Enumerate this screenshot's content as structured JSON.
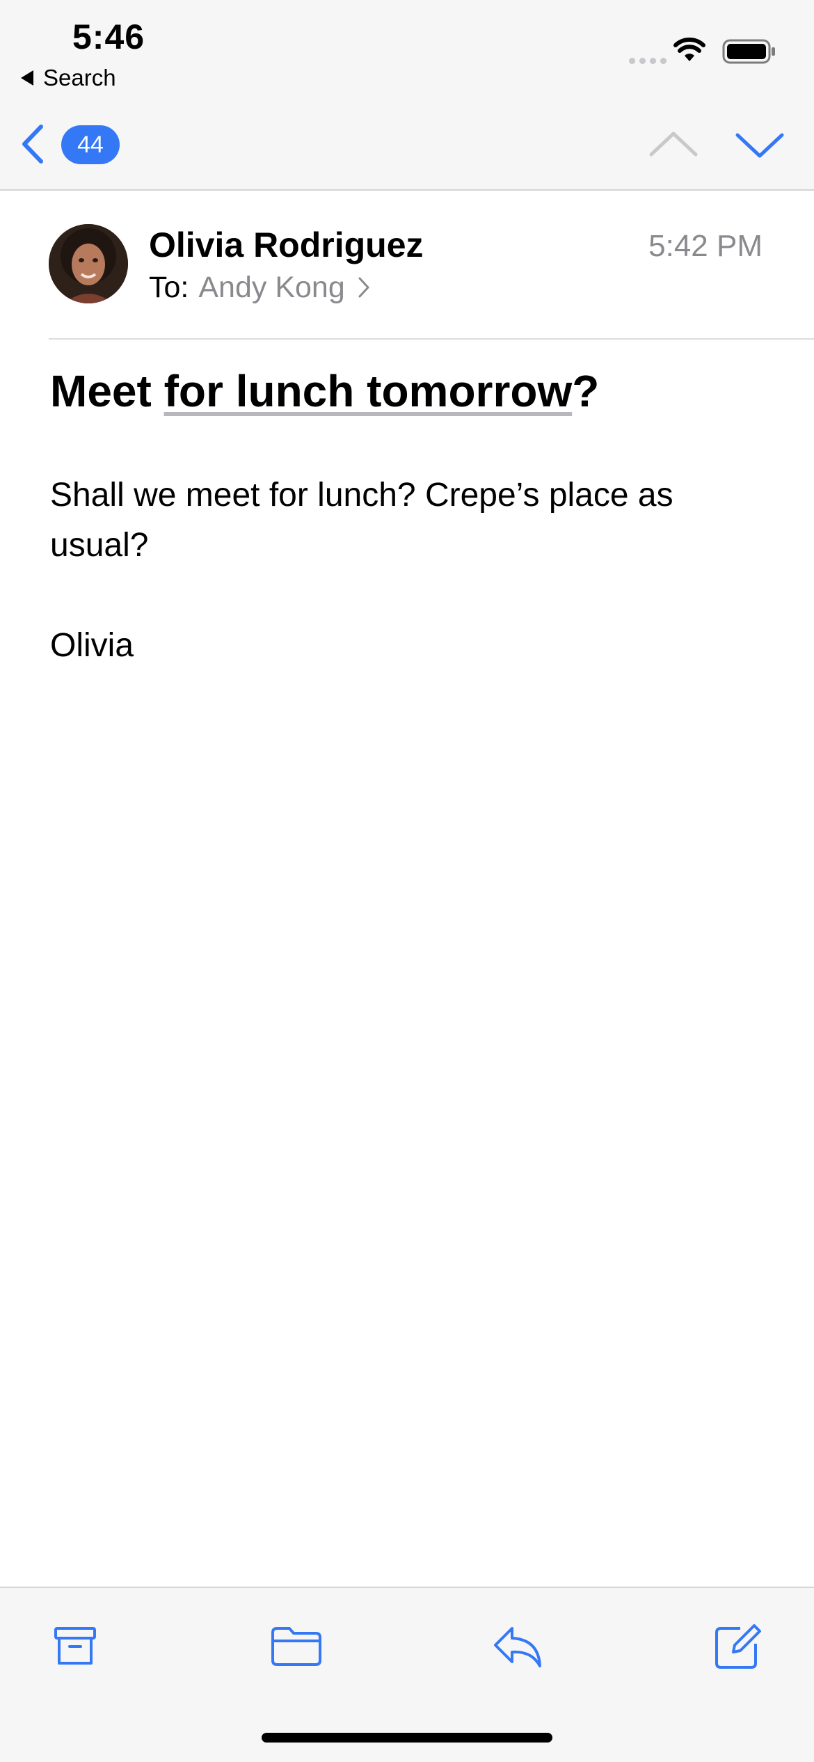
{
  "status_bar": {
    "time": "5:46",
    "back_to_app": "Search"
  },
  "nav": {
    "unread_count": "44"
  },
  "message": {
    "sender": "Olivia Rodriguez",
    "to_label": "To:",
    "recipient": "Andy Kong",
    "time": "5:42 PM",
    "subject_start": "Meet ",
    "subject_highlight": "for lunch tomorrow",
    "subject_end": "?",
    "body": "Shall we meet for lunch?  Crepe’s place as usual?",
    "signature": "Olivia"
  },
  "colors": {
    "accent": "#3478f6",
    "secondary_text": "#8a8a8e",
    "chrome_background": "#f6f6f6"
  },
  "toolbar": {
    "icons": [
      "archive-icon",
      "folder-icon",
      "reply-icon",
      "compose-icon"
    ]
  }
}
